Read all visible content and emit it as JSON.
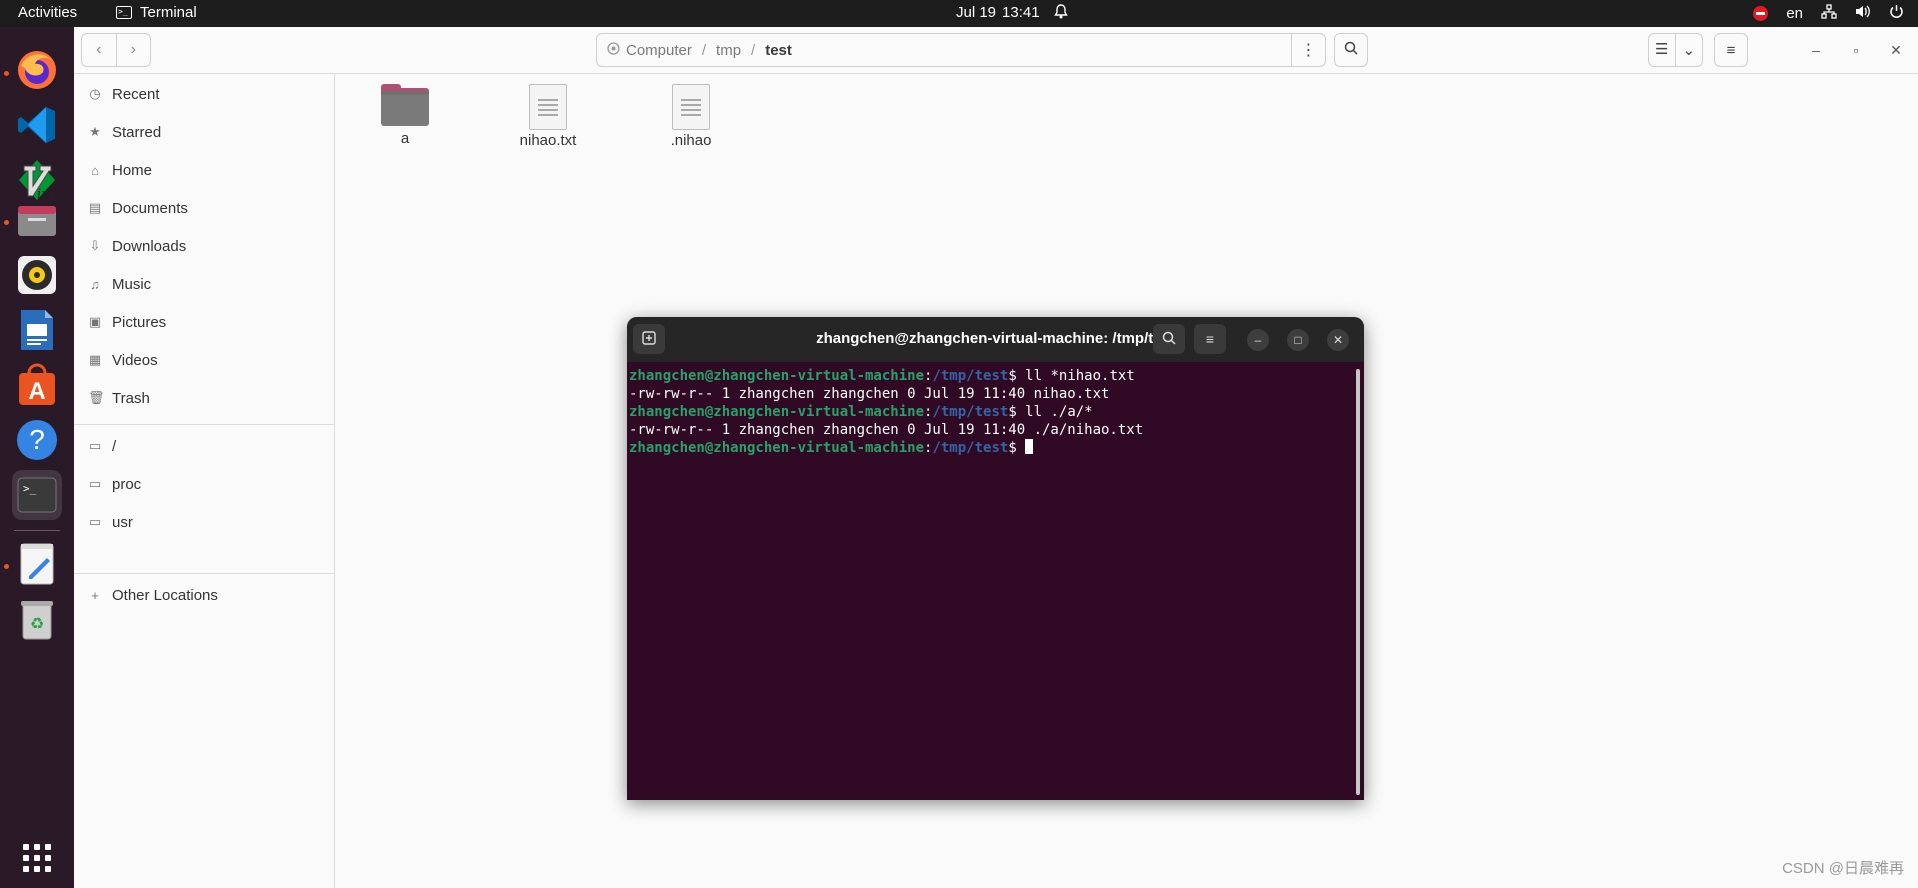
{
  "topbar": {
    "activities": "Activities",
    "app_name": "Terminal",
    "date": "Jul 19",
    "time": "13:41",
    "lang": "en"
  },
  "dock": {
    "apps": [
      "firefox",
      "vscode",
      "vim",
      "files",
      "rhythmbox",
      "writer",
      "software",
      "help",
      "terminal",
      "text-editor",
      "trash",
      "show-apps"
    ]
  },
  "files": {
    "path": {
      "seg1": "Computer",
      "seg2": "tmp",
      "current": "test",
      "sep": "/"
    },
    "sidebar": {
      "recent": "Recent",
      "starred": "Starred",
      "home": "Home",
      "documents": "Documents",
      "downloads": "Downloads",
      "music": "Music",
      "pictures": "Pictures",
      "videos": "Videos",
      "trash": "Trash",
      "root": "/",
      "proc": "proc",
      "usr": "usr",
      "other": "Other Locations"
    },
    "items": [
      {
        "name": "a",
        "type": "folder"
      },
      {
        "name": "nihao.txt",
        "type": "text"
      },
      {
        "name": ".nihao",
        "type": "text"
      }
    ]
  },
  "terminal": {
    "title": "zhangchen@zhangchen-virtual-machine: /tmp/test",
    "user_host": "zhangchen@zhangchen-virtual-machine",
    "colon": ":",
    "path": "/tmp/test",
    "prompt_sign": "$ ",
    "cmd1": "ll *nihao.txt",
    "out1": "-rw-rw-r-- 1 zhangchen zhangchen 0 Jul 19 11:40 nihao.txt",
    "cmd2": "ll ./a/*",
    "out2": "-rw-rw-r-- 1 zhangchen zhangchen 0 Jul 19 11:40 ./a/nihao.txt"
  },
  "watermark": "CSDN @日晨难再"
}
